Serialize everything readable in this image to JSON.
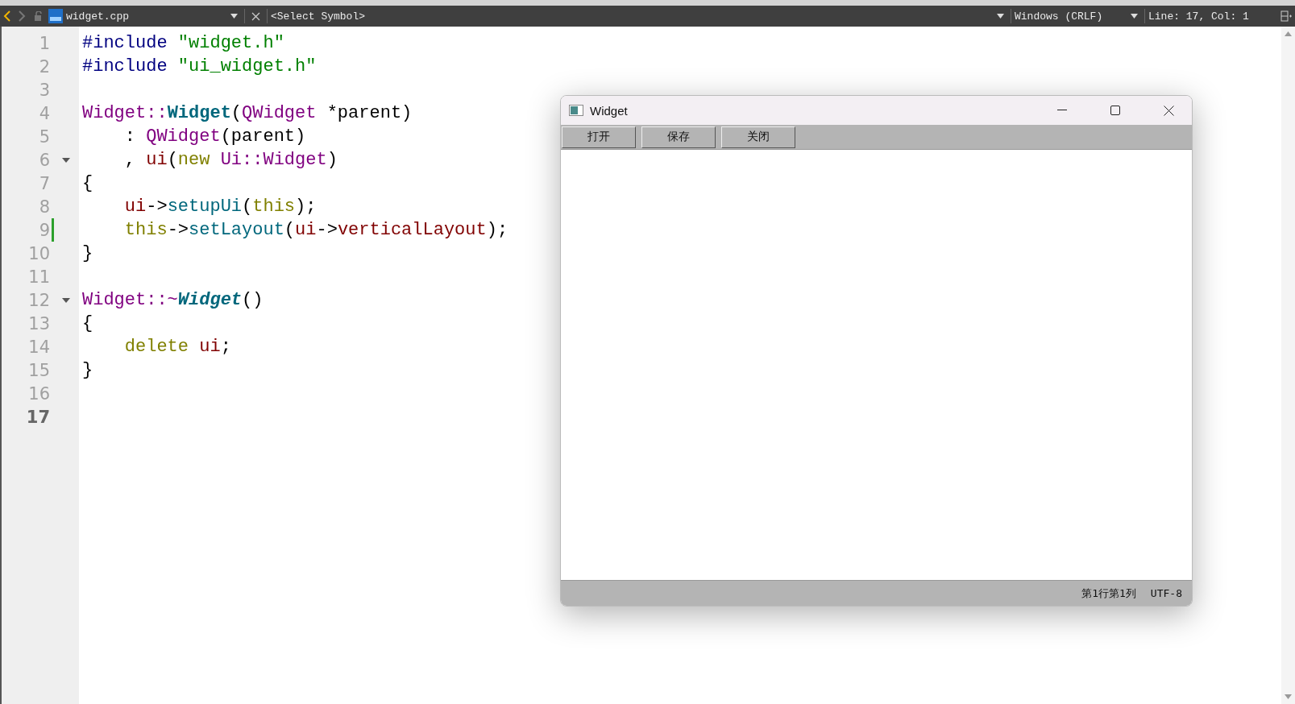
{
  "toolbar": {
    "file_name": "widget.cpp",
    "symbol": "<Select Symbol>",
    "line_ending": "Windows (CRLF)",
    "position": "Line: 17, Col: 1"
  },
  "editor": {
    "lines": [
      {
        "number": "1",
        "foldable": false,
        "modified": false,
        "current": false,
        "tokens": [
          {
            "text": "#include ",
            "kind": "preprocessor"
          },
          {
            "text": "\"widget.h\"",
            "kind": "string"
          }
        ]
      },
      {
        "number": "2",
        "foldable": false,
        "modified": false,
        "current": false,
        "tokens": [
          {
            "text": "#include ",
            "kind": "preprocessor"
          },
          {
            "text": "\"ui_widget.h\"",
            "kind": "string"
          }
        ]
      },
      {
        "number": "3",
        "foldable": false,
        "modified": false,
        "current": false
      },
      {
        "number": "4",
        "foldable": false,
        "modified": false,
        "current": false,
        "tokens": [
          {
            "text": "Widget::",
            "kind": "type"
          },
          {
            "text": "Widget",
            "kind": "definition"
          },
          {
            "text": "(",
            "kind": "plain"
          },
          {
            "text": "QWidget",
            "kind": "type"
          },
          {
            "text": " *parent)",
            "kind": "plain"
          }
        ]
      },
      {
        "number": "5",
        "foldable": false,
        "modified": false,
        "current": false,
        "tokens": [
          {
            "text": "    : ",
            "kind": "plain"
          },
          {
            "text": "QWidget",
            "kind": "type"
          },
          {
            "text": "(parent)",
            "kind": "plain"
          }
        ]
      },
      {
        "number": "6",
        "foldable": true,
        "modified": false,
        "current": false,
        "tokens": [
          {
            "text": "    , ",
            "kind": "plain"
          },
          {
            "text": "ui",
            "kind": "member"
          },
          {
            "text": "(",
            "kind": "plain"
          },
          {
            "text": "new ",
            "kind": "keyword"
          },
          {
            "text": "Ui::Widget",
            "kind": "type"
          },
          {
            "text": ")",
            "kind": "plain"
          }
        ]
      },
      {
        "number": "7",
        "foldable": false,
        "modified": false,
        "current": false,
        "tokens": [
          {
            "text": "{",
            "kind": "plain"
          }
        ]
      },
      {
        "number": "8",
        "foldable": false,
        "modified": false,
        "current": false,
        "tokens": [
          {
            "text": "    ui",
            "kind": "member"
          },
          {
            "text": "->",
            "kind": "plain"
          },
          {
            "text": "setupUi",
            "kind": "method"
          },
          {
            "text": "(",
            "kind": "plain"
          },
          {
            "text": "this",
            "kind": "keyword"
          },
          {
            "text": ");",
            "kind": "plain"
          }
        ]
      },
      {
        "number": "9",
        "foldable": false,
        "modified": true,
        "current": false,
        "tokens": [
          {
            "text": "    this",
            "kind": "keyword"
          },
          {
            "text": "->",
            "kind": "plain"
          },
          {
            "text": "setLayout",
            "kind": "method"
          },
          {
            "text": "(",
            "kind": "plain"
          },
          {
            "text": "ui",
            "kind": "member"
          },
          {
            "text": "->",
            "kind": "plain"
          },
          {
            "text": "verticalLayout",
            "kind": "member"
          },
          {
            "text": ");",
            "kind": "plain"
          }
        ]
      },
      {
        "number": "10",
        "foldable": false,
        "modified": false,
        "current": false,
        "tokens": [
          {
            "text": "}",
            "kind": "plain"
          }
        ]
      },
      {
        "number": "11",
        "foldable": false,
        "modified": false,
        "current": false
      },
      {
        "number": "12",
        "foldable": true,
        "modified": false,
        "current": false,
        "tokens": [
          {
            "text": "Widget::~",
            "kind": "type"
          },
          {
            "text": "Widget",
            "kind": "destructor"
          },
          {
            "text": "()",
            "kind": "plain"
          }
        ]
      },
      {
        "number": "13",
        "foldable": false,
        "modified": false,
        "current": false,
        "tokens": [
          {
            "text": "{",
            "kind": "plain"
          }
        ]
      },
      {
        "number": "14",
        "foldable": false,
        "modified": false,
        "current": false,
        "tokens": [
          {
            "text": "    delete ",
            "kind": "keyword"
          },
          {
            "text": "ui",
            "kind": "member"
          },
          {
            "text": ";",
            "kind": "plain"
          }
        ]
      },
      {
        "number": "15",
        "foldable": false,
        "modified": false,
        "current": false,
        "tokens": [
          {
            "text": "}",
            "kind": "plain"
          }
        ]
      },
      {
        "number": "16",
        "foldable": false,
        "modified": false,
        "current": false
      },
      {
        "number": "17",
        "foldable": false,
        "modified": false,
        "current": true
      }
    ]
  },
  "app_window": {
    "title": "Widget",
    "buttons": [
      "打开",
      "保存",
      "关闭"
    ],
    "status": [
      "第1行第1列",
      "UTF-8"
    ]
  }
}
